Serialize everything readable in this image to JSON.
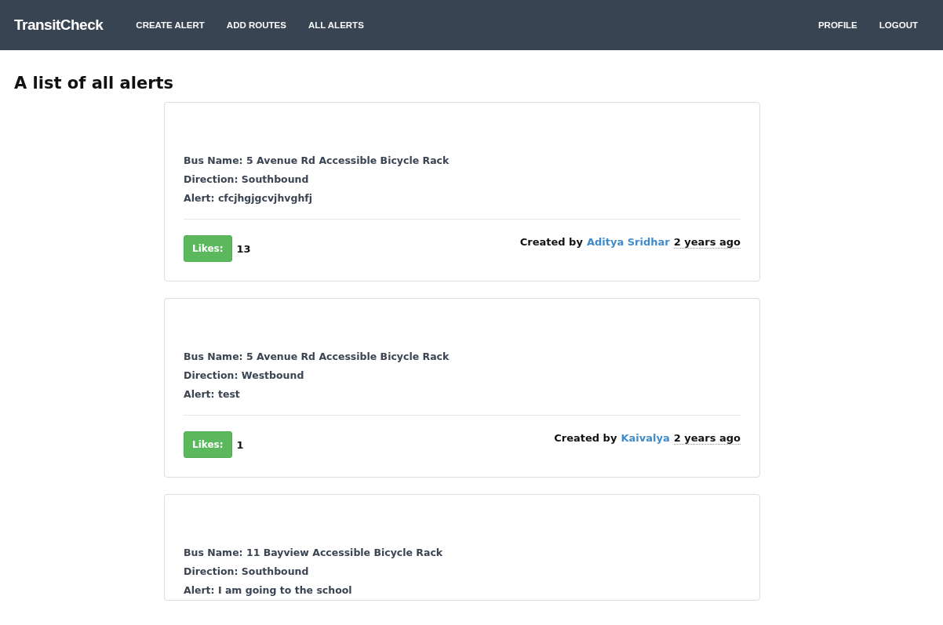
{
  "navbar": {
    "brand": "TransitCheck",
    "links": [
      {
        "label": "CREATE ALERT"
      },
      {
        "label": "ADD ROUTES"
      },
      {
        "label": "ALL ALERTS"
      }
    ],
    "right_links": [
      {
        "label": "PROFILE"
      },
      {
        "label": "LOGOUT"
      }
    ]
  },
  "page_title": "A list of all alerts",
  "alerts": [
    {
      "bus_name": "Bus Name: 5 Avenue Rd Accessible Bicycle Rack",
      "direction": "Direction: Southbound",
      "alert": "Alert: cfcjhgjgcvjhvghfj",
      "likes_label": "Likes:",
      "likes": "13",
      "created_by": "Created by",
      "author": "Aditya Sridhar",
      "time": "2 years ago"
    },
    {
      "bus_name": "Bus Name: 5 Avenue Rd Accessible Bicycle Rack",
      "direction": "Direction: Westbound",
      "alert": "Alert: test",
      "likes_label": "Likes:",
      "likes": "1",
      "created_by": "Created by",
      "author": "Kaivalya",
      "time": "2 years ago"
    },
    {
      "bus_name": "Bus Name: 11 Bayview Accessible Bicycle Rack",
      "direction": "Direction: Southbound",
      "alert": "Alert: I am going to the school"
    }
  ]
}
